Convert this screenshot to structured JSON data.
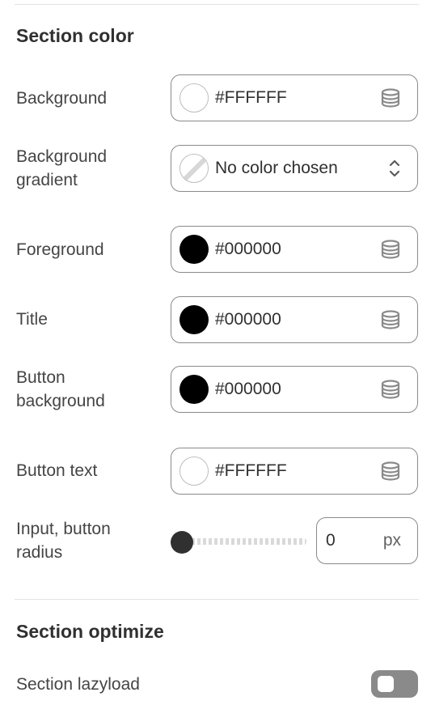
{
  "section_color": {
    "title": "Section color",
    "rows": [
      {
        "label": "Background",
        "value": "#FFFFFF",
        "swatch": "#FFFFFF",
        "icon": "database-icon"
      },
      {
        "label": "Background gradient",
        "value": "No color chosen",
        "swatch": "none",
        "icon": "chevron-up-down-icon"
      },
      {
        "label": "Foreground",
        "value": "#000000",
        "swatch": "#000000",
        "icon": "database-icon"
      },
      {
        "label": "Title",
        "value": "#000000",
        "swatch": "#000000",
        "icon": "database-icon"
      },
      {
        "label": "Button background",
        "value": "#000000",
        "swatch": "#000000",
        "icon": "database-icon"
      },
      {
        "label": "Button text",
        "value": "#FFFFFF",
        "swatch": "#FFFFFF",
        "icon": "database-icon"
      }
    ],
    "radius": {
      "label": "Input, button radius",
      "value": "0",
      "unit": "px",
      "slider_fraction": 0
    }
  },
  "section_optimize": {
    "title": "Section optimize",
    "lazyload": {
      "label": "Section lazyload",
      "enabled": false
    }
  }
}
